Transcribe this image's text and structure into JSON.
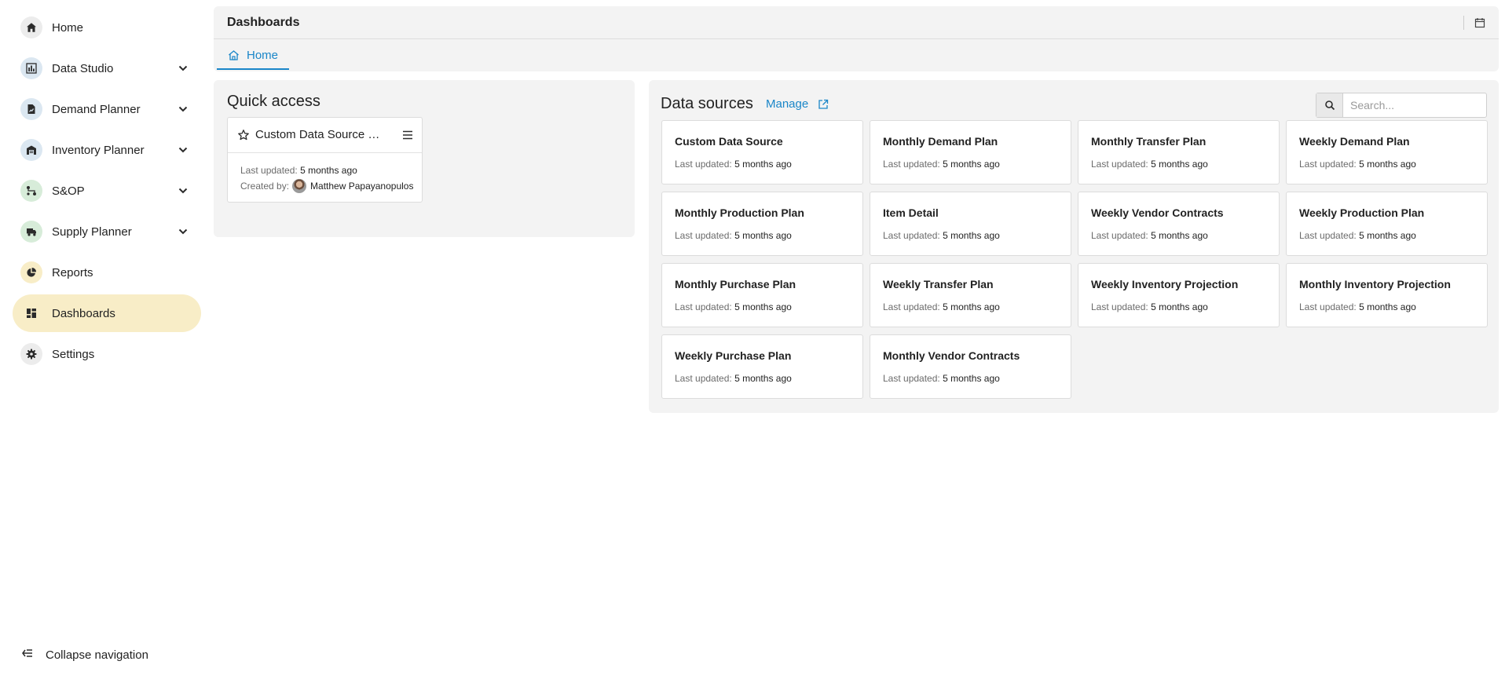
{
  "nav": {
    "items": [
      {
        "label": "Home"
      },
      {
        "label": "Data Studio"
      },
      {
        "label": "Demand Planner"
      },
      {
        "label": "Inventory Planner"
      },
      {
        "label": "S&OP"
      },
      {
        "label": "Supply Planner"
      },
      {
        "label": "Reports"
      },
      {
        "label": "Dashboards"
      },
      {
        "label": "Settings"
      }
    ],
    "collapse_label": "Collapse navigation",
    "active": "Dashboards"
  },
  "header": {
    "title": "Dashboards",
    "tab_home": "Home"
  },
  "quick_access": {
    "title": "Quick access",
    "card": {
      "name": "Custom Data Source Dashboard",
      "updated_key": "Last updated:",
      "updated_value": "5 months ago",
      "created_key": "Created by:",
      "created_value": "Matthew Papayanopulos"
    }
  },
  "data_sources": {
    "title": "Data sources",
    "manage_label": "Manage",
    "search_placeholder": "Search...",
    "updated_key": "Last updated:",
    "items": [
      {
        "name": "Custom Data Source",
        "updated": "5 months ago"
      },
      {
        "name": "Monthly Demand Plan",
        "updated": "5 months ago"
      },
      {
        "name": "Monthly Transfer Plan",
        "updated": "5 months ago"
      },
      {
        "name": "Weekly Demand Plan",
        "updated": "5 months ago"
      },
      {
        "name": "Monthly Production Plan",
        "updated": "5 months ago"
      },
      {
        "name": "Item Detail",
        "updated": "5 months ago"
      },
      {
        "name": "Weekly Vendor Contracts",
        "updated": "5 months ago"
      },
      {
        "name": "Weekly Production Plan",
        "updated": "5 months ago"
      },
      {
        "name": "Monthly Purchase Plan",
        "updated": "5 months ago"
      },
      {
        "name": "Weekly Transfer Plan",
        "updated": "5 months ago"
      },
      {
        "name": "Weekly Inventory Projection",
        "updated": "5 months ago"
      },
      {
        "name": "Monthly Inventory Projection",
        "updated": "5 months ago"
      },
      {
        "name": "Weekly Purchase Plan",
        "updated": "5 months ago"
      },
      {
        "name": "Monthly Vendor Contracts",
        "updated": "5 months ago"
      }
    ]
  },
  "colors": {
    "accent": "#1a86c8",
    "active_nav_bg": "#f8edc7",
    "panel_bg": "#f3f3f3"
  }
}
